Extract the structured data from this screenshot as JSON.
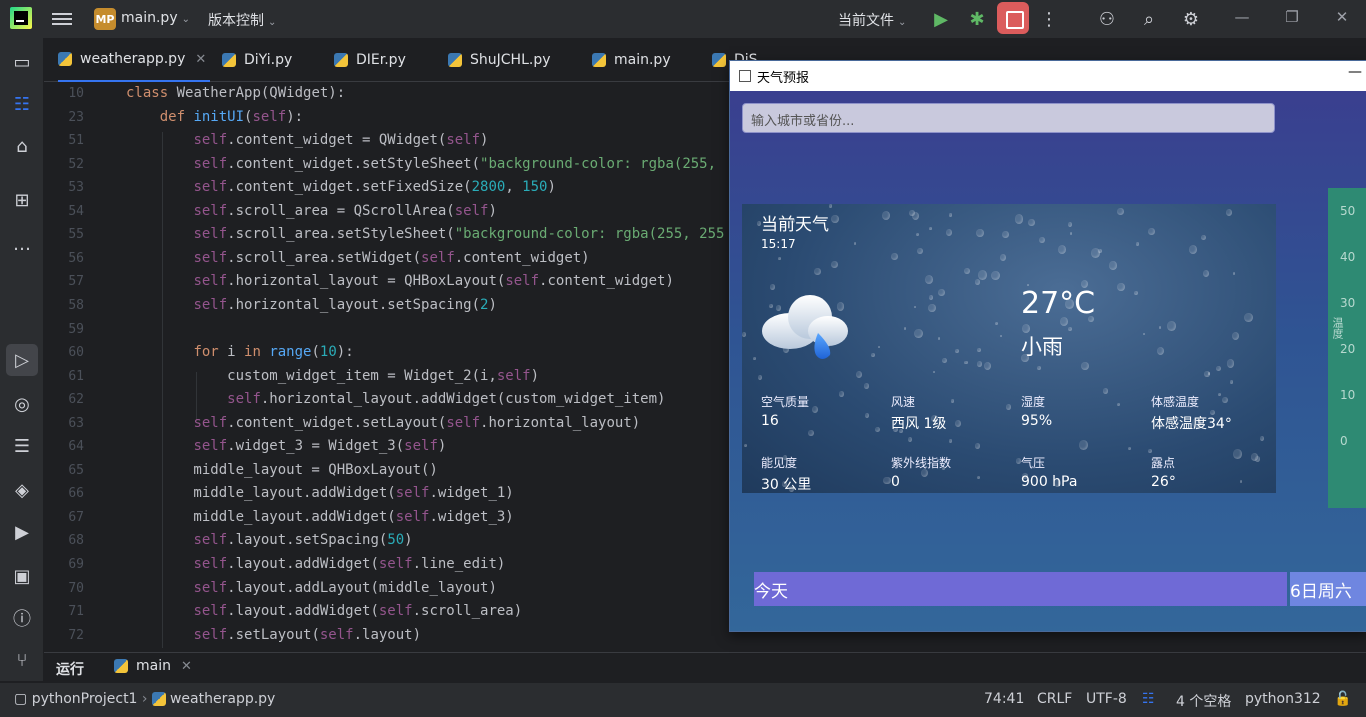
{
  "titlebar": {
    "project_badge": "MP",
    "project_name": "main.py",
    "vcs": "版本控制",
    "run_config": "当前文件"
  },
  "tabs": [
    {
      "label": "weatherapp.py",
      "active": true
    },
    {
      "label": "DiYi.py"
    },
    {
      "label": "DIEr.py"
    },
    {
      "label": "ShuJCHL.py"
    },
    {
      "label": "main.py"
    },
    {
      "label": "DiS"
    }
  ],
  "code_lines": [
    {
      "n": "10",
      "html": "<span class=\"kw\">class</span> WeatherApp(QWidget):"
    },
    {
      "n": "23",
      "html": "    <span class=\"kw\">def</span> <span class=\"fn\">initUI</span>(<span class=\"sf\">self</span>):"
    },
    {
      "n": "51",
      "html": "        <span class=\"sf\">self</span>.content_widget = QWidget(<span class=\"sf\">self</span>)"
    },
    {
      "n": "52",
      "html": "        <span class=\"sf\">self</span>.content_widget.setStyleSheet(<span class=\"st\">\"background-color: rgba(255,</span>"
    },
    {
      "n": "53",
      "html": "        <span class=\"sf\">self</span>.content_widget.setFixedSize(<span class=\"nm\">2800</span>, <span class=\"nm\">150</span>)"
    },
    {
      "n": "54",
      "html": "        <span class=\"sf\">self</span>.scroll_area = QScrollArea(<span class=\"sf\">self</span>)"
    },
    {
      "n": "55",
      "html": "        <span class=\"sf\">self</span>.scroll_area.setStyleSheet(<span class=\"st\">\"background-color: rgba(255, 255</span>"
    },
    {
      "n": "56",
      "html": "        <span class=\"sf\">self</span>.scroll_area.setWidget(<span class=\"sf\">self</span>.content_widget)"
    },
    {
      "n": "57",
      "html": "        <span class=\"sf\">self</span>.horizontal_layout = QHBoxLayout(<span class=\"sf\">self</span>.content_widget)"
    },
    {
      "n": "58",
      "html": "        <span class=\"sf\">self</span>.horizontal_layout.setSpacing(<span class=\"nm\">2</span>)"
    },
    {
      "n": "59",
      "html": ""
    },
    {
      "n": "60",
      "html": "        <span class=\"kw\">for</span> i <span class=\"kw\">in</span> <span class=\"fn\">range</span>(<span class=\"nm\">10</span>):"
    },
    {
      "n": "61",
      "html": "            custom_widget_item = Widget_2(i,<span class=\"sf\">self</span>)"
    },
    {
      "n": "62",
      "html": "            <span class=\"sf\">self</span>.horizontal_layout.addWidget(custom_widget_item)"
    },
    {
      "n": "63",
      "html": "        <span class=\"sf\">self</span>.content_widget.setLayout(<span class=\"sf\">self</span>.horizontal_layout)"
    },
    {
      "n": "64",
      "html": "        <span class=\"sf\">self</span>.widget_3 = Widget_3(<span class=\"sf\">self</span>)"
    },
    {
      "n": "65",
      "html": "        middle_layout = QHBoxLayout()"
    },
    {
      "n": "66",
      "html": "        middle_layout.addWidget(<span class=\"sf\">self</span>.widget_1)"
    },
    {
      "n": "67",
      "html": "        middle_layout.addWidget(<span class=\"sf\">self</span>.widget_3)"
    },
    {
      "n": "68",
      "html": "        <span class=\"sf\">self</span>.layout.setSpacing(<span class=\"nm\">50</span>)"
    },
    {
      "n": "69",
      "html": "        <span class=\"sf\">self</span>.layout.addWidget(<span class=\"sf\">self</span>.line_edit)"
    },
    {
      "n": "70",
      "html": "        <span class=\"sf\">self</span>.layout.addLayout(middle_layout)"
    },
    {
      "n": "71",
      "html": "        <span class=\"sf\">self</span>.layout.addWidget(<span class=\"sf\">self</span>.scroll_area)"
    },
    {
      "n": "72",
      "html": "        <span class=\"sf\">self</span>.setLayout(<span class=\"sf\">self</span>.layout)"
    }
  ],
  "bottom": {
    "run_label": "运行",
    "run_tab": "main"
  },
  "status": {
    "project": "pythonProject1",
    "file": "weatherapp.py",
    "position": "74:41",
    "line_sep": "CRLF",
    "encoding": "UTF-8",
    "indent": "4 个空格",
    "interpreter": "python312"
  },
  "weather": {
    "window_title": "天气预报",
    "search_placeholder": "输入城市或省份...",
    "card_title": "当前天气",
    "time": "15:17",
    "temperature": "27°C",
    "condition": "小雨",
    "stats": [
      {
        "label": "空气质量",
        "value": "16"
      },
      {
        "label": "风速",
        "value": "西风 1级"
      },
      {
        "label": "湿度",
        "value": "95%"
      },
      {
        "label": "体感温度",
        "value": "体感温度34°"
      },
      {
        "label": "能见度",
        "value": "30 公里"
      },
      {
        "label": "紫外线指数",
        "value": "0"
      },
      {
        "label": "气压",
        "value": "900 hPa"
      },
      {
        "label": "露点",
        "value": "26°"
      }
    ],
    "side_axis": [
      "50",
      "40",
      "30",
      "20",
      "10",
      "0"
    ],
    "side_label": "温度",
    "days": [
      {
        "label": "今天"
      },
      {
        "label": "6日周六"
      }
    ],
    "scroll_position": 0.0
  }
}
